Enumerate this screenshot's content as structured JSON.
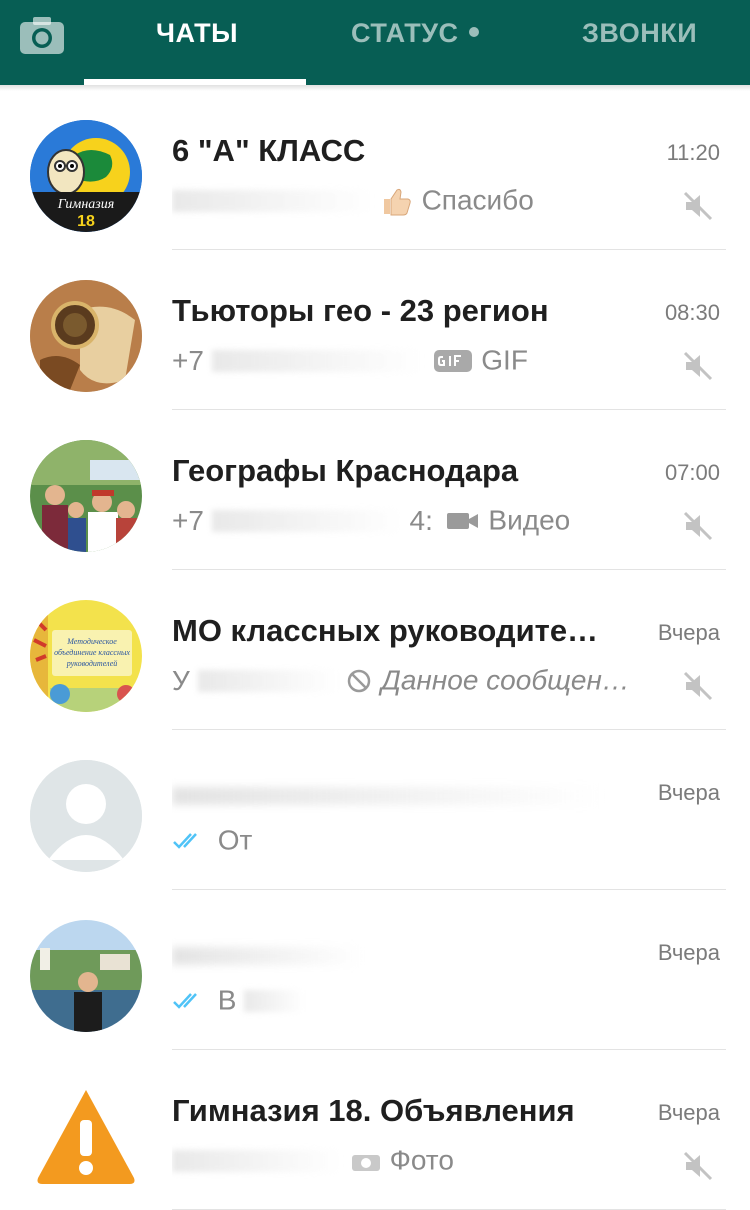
{
  "tabs": {
    "chats": "ЧАТЫ",
    "status": "СТАТУС",
    "calls": "ЗВОНКИ"
  },
  "chats": [
    {
      "name": "6 \"А\" КЛАСС",
      "time": "11:20",
      "sender": "",
      "message": "Спасибо",
      "muted": true
    },
    {
      "name": "Тьюторы гео - 23 регион",
      "time": "08:30",
      "sender": "+7",
      "message": "GIF",
      "muted": true
    },
    {
      "name": "Географы Краснодара",
      "time": "07:00",
      "sender": "+7",
      "sender_suffix": "4:",
      "message": "Видео",
      "muted": true
    },
    {
      "name": "МО классных руководите…",
      "time": "Вчера",
      "sender": "У",
      "message": "Данное сообщен…",
      "muted": true
    },
    {
      "name": "",
      "time": "Вчера",
      "sender": "",
      "message": "От",
      "muted": false
    },
    {
      "name": "",
      "time": "Вчера",
      "sender": "",
      "message": "В",
      "muted": false
    },
    {
      "name": "Гимназия 18. Объявления",
      "time": "Вчера",
      "sender": "",
      "message": "Фото",
      "muted": true
    }
  ],
  "avatars": {
    "avatar_1_text": "Гимназия",
    "avatar_1_number": "18",
    "avatar_4_text_1": "Методическое",
    "avatar_4_text_2": "объединение классных",
    "avatar_4_text_3": "руководителей"
  },
  "colors": {
    "header": "#075e54",
    "tick_blue": "#4fc3f7",
    "text_grey": "#8a8a8a",
    "warning_orange": "#f39a1f"
  }
}
